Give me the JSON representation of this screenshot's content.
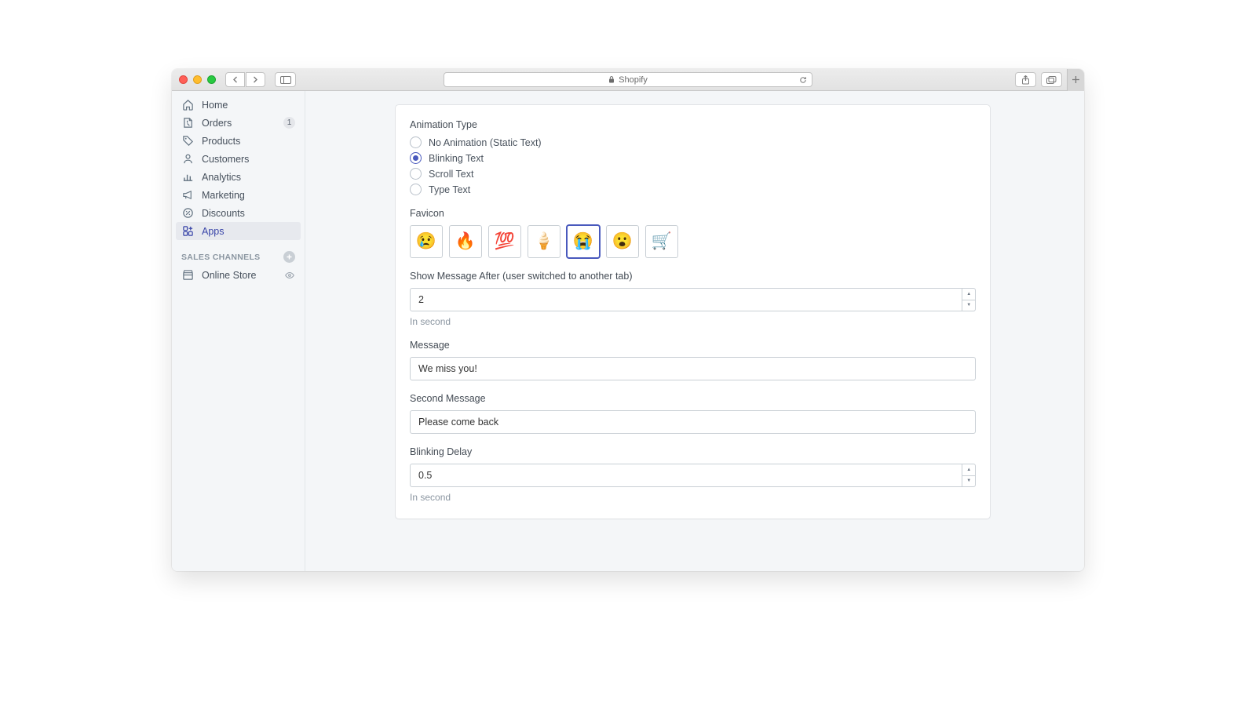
{
  "browser": {
    "url_label": "Shopify"
  },
  "sidebar": {
    "items": [
      {
        "label": "Home",
        "icon": "home"
      },
      {
        "label": "Orders",
        "icon": "orders",
        "badge": "1"
      },
      {
        "label": "Products",
        "icon": "products"
      },
      {
        "label": "Customers",
        "icon": "customers"
      },
      {
        "label": "Analytics",
        "icon": "analytics"
      },
      {
        "label": "Marketing",
        "icon": "marketing"
      },
      {
        "label": "Discounts",
        "icon": "discounts"
      },
      {
        "label": "Apps",
        "icon": "apps",
        "active": true
      }
    ],
    "section_title": "SALES CHANNELS",
    "channels": [
      {
        "label": "Online Store"
      }
    ]
  },
  "form": {
    "animation_type": {
      "label": "Animation Type",
      "options": [
        "No Animation (Static Text)",
        "Blinking Text",
        "Scroll Text",
        "Type Text"
      ],
      "selected_index": 1
    },
    "favicon": {
      "label": "Favicon",
      "options": [
        "😢",
        "🔥",
        "💯",
        "🍦",
        "😭",
        "😮",
        "🛒"
      ],
      "selected_index": 4
    },
    "show_after": {
      "label": "Show Message After (user switched to another tab)",
      "value": "2",
      "help": "In second"
    },
    "message": {
      "label": "Message",
      "value": "We miss you!"
    },
    "second_message": {
      "label": "Second Message",
      "value": "Please come back"
    },
    "blinking_delay": {
      "label": "Blinking Delay",
      "value": "0.5",
      "help": "In second"
    }
  }
}
